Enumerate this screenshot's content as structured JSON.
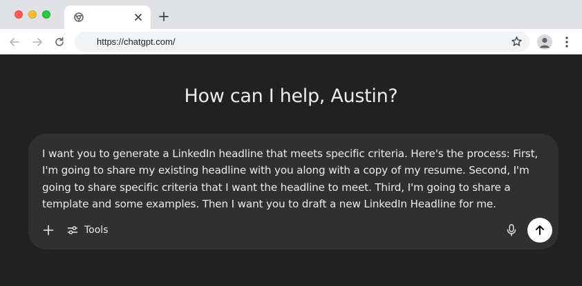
{
  "browser": {
    "url": "https://chatgpt.com/",
    "icons": {
      "tab_favicon": "chrome-icon",
      "tab_close": "close-icon",
      "new_tab": "plus-icon",
      "back": "arrow-left-icon",
      "forward": "arrow-right-icon",
      "reload": "reload-icon",
      "bookmark": "star-icon",
      "profile": "profile-icon",
      "menu": "kebab-menu-icon"
    }
  },
  "main": {
    "heading": "How can I help, Austin?",
    "composer": {
      "prompt_text": "I want you to generate a LinkedIn headline that meets specific criteria. Here's the process: First, I'm going to share my existing headline with you along with a copy of my resume. Second, I'm going to share specific criteria that I want the headline to meet. Third, I'm going to share a template and some examples. Then I want you to draft a new LinkedIn Headline for me.",
      "tools_label": "Tools",
      "icons": {
        "attach": "plus-icon",
        "tools": "sliders-icon",
        "voice": "microphone-icon",
        "send": "arrow-up-icon"
      }
    }
  },
  "colors": {
    "page_background": "#212121",
    "composer_background": "#303030",
    "text": "#ececec",
    "send_button": "#ffffff"
  }
}
